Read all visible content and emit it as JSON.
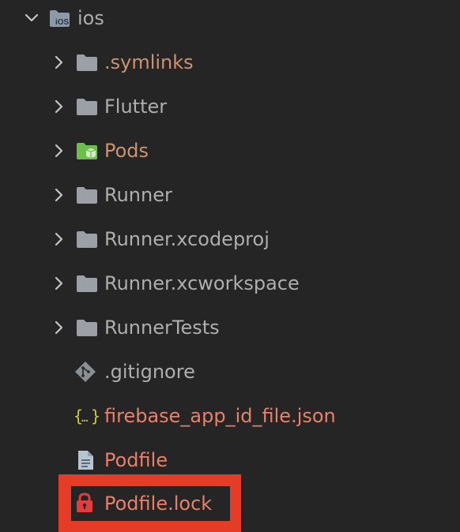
{
  "explorer": {
    "root": {
      "label": "ios",
      "icon": "ios-folder-icon",
      "expanded": true
    },
    "items": [
      {
        "label": ".symlinks",
        "icon": "folder-icon",
        "kind": "folder",
        "color": "#cc9370"
      },
      {
        "label": "Flutter",
        "icon": "folder-icon",
        "kind": "folder",
        "color": "#aeaeae"
      },
      {
        "label": "Pods",
        "icon": "pods-folder-icon",
        "kind": "folder",
        "color": "#cc9370"
      },
      {
        "label": "Runner",
        "icon": "folder-icon",
        "kind": "folder",
        "color": "#aeaeae"
      },
      {
        "label": "Runner.xcodeproj",
        "icon": "folder-icon",
        "kind": "folder",
        "color": "#aeaeae"
      },
      {
        "label": "Runner.xcworkspace",
        "icon": "folder-icon",
        "kind": "folder",
        "color": "#aeaeae"
      },
      {
        "label": "RunnerTests",
        "icon": "folder-icon",
        "kind": "folder",
        "color": "#aeaeae"
      },
      {
        "label": ".gitignore",
        "icon": "git-icon",
        "kind": "file",
        "color": "#aeaeae"
      },
      {
        "label": "firebase_app_id_file.json",
        "icon": "json-braces-icon",
        "kind": "file",
        "color": "#e8806a"
      },
      {
        "label": "Podfile",
        "icon": "document-icon",
        "kind": "file",
        "color": "#e8806a"
      },
      {
        "label": "Podfile.lock",
        "icon": "lock-icon",
        "kind": "file",
        "color": "#e8806a",
        "highlighted": true
      }
    ]
  },
  "colors": {
    "background": "#252526",
    "highlight": "#e63b26",
    "chevron": "#c5c5c5",
    "folder": "#9aa0a6",
    "pods_folder": "#6cbf4a",
    "json_icon": "#cbcb41",
    "lock_icon": "#e63b3b"
  }
}
